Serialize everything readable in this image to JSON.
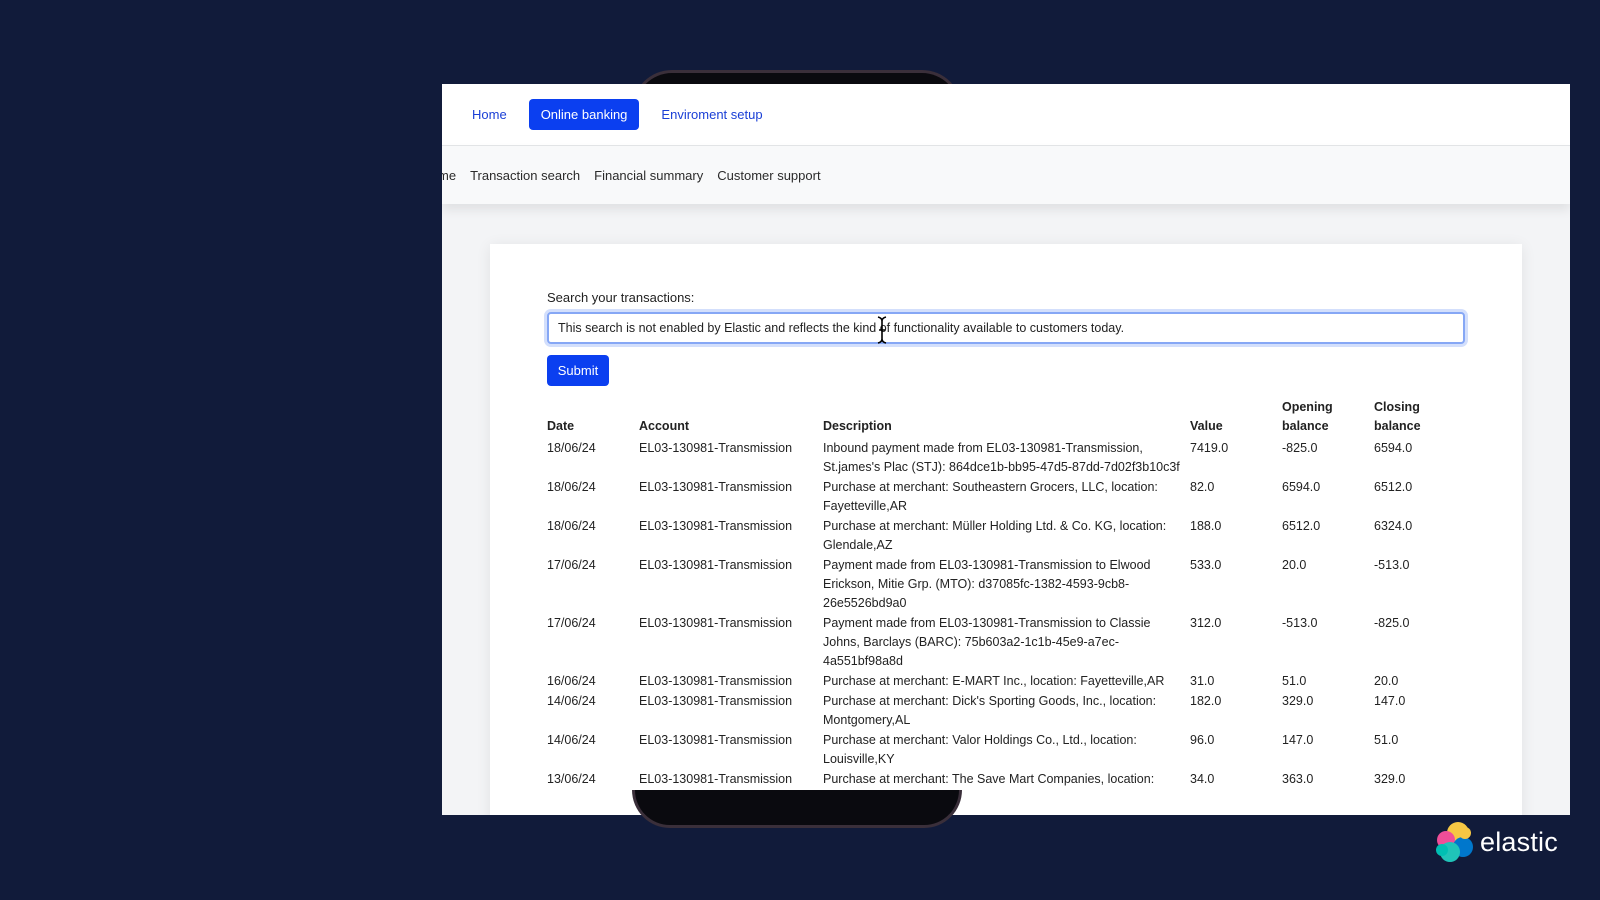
{
  "nav": {
    "items": [
      {
        "label": "Home"
      },
      {
        "label": "Online banking",
        "active": true
      },
      {
        "label": "Enviroment setup"
      }
    ]
  },
  "subnav": {
    "items": [
      {
        "label": "me"
      },
      {
        "label": "Transaction search"
      },
      {
        "label": "Financial summary"
      },
      {
        "label": "Customer support"
      }
    ]
  },
  "search": {
    "label": "Search your transactions:",
    "value": "This search is not enabled by Elastic and reflects the kind of functionality available to customers today.",
    "submit_label": "Submit"
  },
  "table": {
    "headers": {
      "date": "Date",
      "account": "Account",
      "description": "Description",
      "value": "Value",
      "opening_1": "Opening",
      "opening_2": "balance",
      "closing_1": "Closing",
      "closing_2": "balance"
    },
    "rows": [
      {
        "date": "18/06/24",
        "account": "EL03-130981-Transmission",
        "description": "Inbound payment made from EL03-130981-Transmission, St.james's Plac (STJ): 864dce1b-bb95-47d5-87dd-7d02f3b10c3f",
        "value": "7419.0",
        "opening": "-825.0",
        "closing": "6594.0"
      },
      {
        "date": "18/06/24",
        "account": "EL03-130981-Transmission",
        "description": "Purchase at merchant: Southeastern Grocers, LLC, location: Fayetteville,AR",
        "value": "82.0",
        "opening": "6594.0",
        "closing": "6512.0"
      },
      {
        "date": "18/06/24",
        "account": "EL03-130981-Transmission",
        "description": "Purchase at merchant: Müller Holding Ltd. & Co. KG, location: Glendale,AZ",
        "value": "188.0",
        "opening": "6512.0",
        "closing": "6324.0"
      },
      {
        "date": "17/06/24",
        "account": "EL03-130981-Transmission",
        "description": "Payment made from EL03-130981-Transmission to Elwood Erickson, Mitie Grp. (MTO): d37085fc-1382-4593-9cb8-26e5526bd9a0",
        "value": "533.0",
        "opening": "20.0",
        "closing": "-513.0"
      },
      {
        "date": "17/06/24",
        "account": "EL03-130981-Transmission",
        "description": "Payment made from EL03-130981-Transmission to Classie Johns, Barclays (BARC): 75b603a2-1c1b-45e9-a7ec-4a551bf98a8d",
        "value": "312.0",
        "opening": "-513.0",
        "closing": "-825.0"
      },
      {
        "date": "16/06/24",
        "account": "EL03-130981-Transmission",
        "description": "Purchase at merchant: E-MART Inc., location: Fayetteville,AR",
        "value": "31.0",
        "opening": "51.0",
        "closing": "20.0"
      },
      {
        "date": "14/06/24",
        "account": "EL03-130981-Transmission",
        "description": "Purchase at merchant: Dick's Sporting Goods, Inc., location: Montgomery,AL",
        "value": "182.0",
        "opening": "329.0",
        "closing": "147.0"
      },
      {
        "date": "14/06/24",
        "account": "EL03-130981-Transmission",
        "description": "Purchase at merchant: Valor Holdings Co., Ltd., location: Louisville,KY",
        "value": "96.0",
        "opening": "147.0",
        "closing": "51.0"
      },
      {
        "date": "13/06/24",
        "account": "EL03-130981-Transmission",
        "description": "Purchase at merchant: The Save Mart Companies, location:",
        "value": "34.0",
        "opening": "363.0",
        "closing": "329.0"
      }
    ]
  },
  "brand": {
    "logo_text": "elastic",
    "icon": "elastic-logo-icon"
  },
  "colors": {
    "background": "#111b3a",
    "accent": "#0b3ff0",
    "link": "#1a3fd6"
  }
}
